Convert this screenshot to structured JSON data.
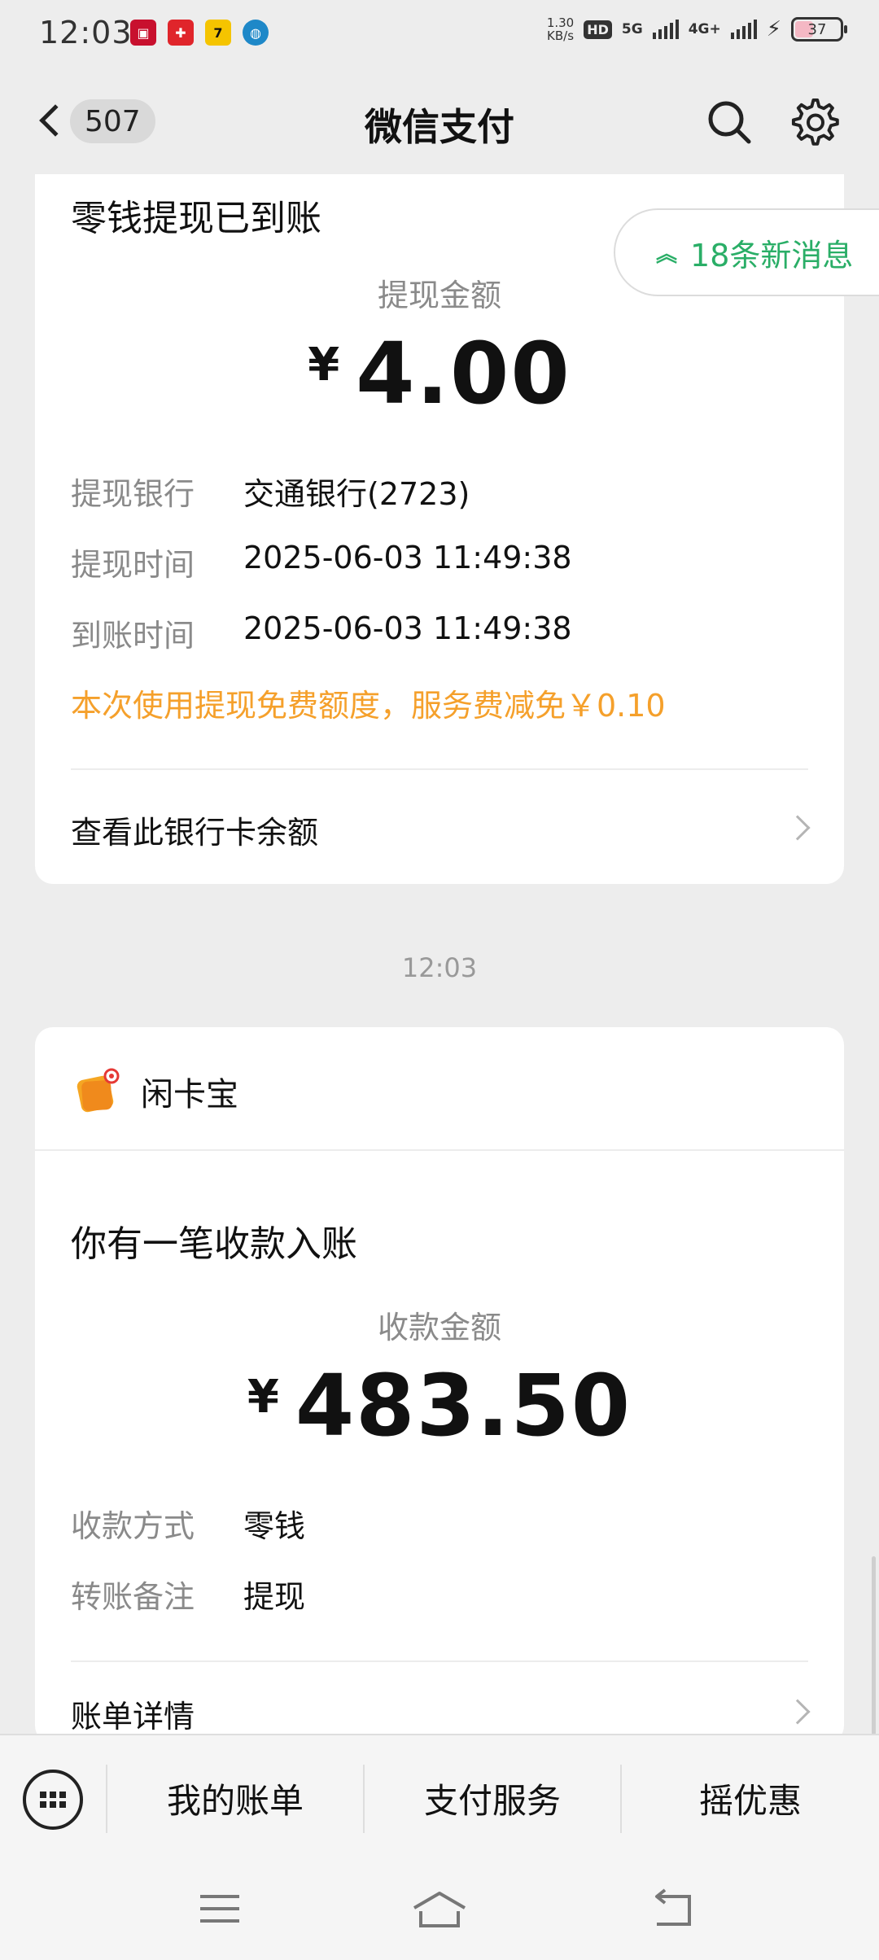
{
  "status_bar": {
    "time": "12:03",
    "net_speed_top": "1.30",
    "net_speed_unit": "KB/s",
    "hd_label": "HD",
    "sim_label": "5G",
    "sim2_label": "4G+",
    "battery": "37",
    "notification_icons": [
      "bank-app-icon",
      "union-app-icon",
      "game-app-icon",
      "browser-app-icon"
    ]
  },
  "nav": {
    "unread_count": "507",
    "title": "微信支付"
  },
  "new_messages": "18条新消息",
  "withdraw_card": {
    "heading": "零钱提现已到账",
    "amount_label": "提现金额",
    "currency": "¥",
    "amount": "4.00",
    "rows": [
      {
        "key": "提现银行",
        "value": "交通银行(2723)"
      },
      {
        "key": "提现时间",
        "value": "2025-06-03 11:49:38"
      },
      {
        "key": "到账时间",
        "value": "2025-06-03 11:49:38"
      }
    ],
    "note": "本次使用提现免费额度，服务费减免￥0.10",
    "link": "查看此银行卡余额"
  },
  "timestamp": "12:03",
  "payment_card": {
    "merchant": "闲卡宝",
    "heading": "你有一笔收款入账",
    "amount_label": "收款金额",
    "currency": "¥",
    "amount": "483.50",
    "rows": [
      {
        "key": "收款方式",
        "value": "零钱"
      },
      {
        "key": "转账备注",
        "value": "提现"
      }
    ],
    "link": "账单详情"
  },
  "bottom_menu": {
    "items": [
      "我的账单",
      "支付服务",
      "摇优惠"
    ]
  },
  "colors": {
    "accent_green": "#2aae67",
    "note_orange": "#f5a02b",
    "background": "#ededed"
  }
}
